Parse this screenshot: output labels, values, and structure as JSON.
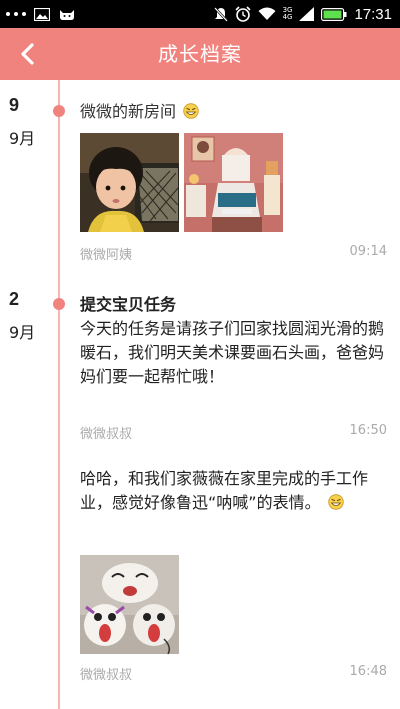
{
  "status_bar": {
    "time": "17:31",
    "network_label_top": "3G",
    "network_label_bottom": "4G",
    "icons": [
      "more-dots-icon",
      "image-icon",
      "cat-icon",
      "mute-icon",
      "alarm-icon",
      "wifi-icon",
      "signal-icon",
      "battery-icon"
    ]
  },
  "header": {
    "title": "成长档案",
    "back_icon": "chevron-left-icon",
    "bar_color": "#f1837f"
  },
  "colors": {
    "accent": "#f1837f",
    "timeline": "#f6b4b2",
    "meta_text": "#aaaaaa"
  },
  "timeline": [
    {
      "day": "9",
      "month": "9月",
      "posts": [
        {
          "title": "微微的新房间",
          "title_emoji": "grin-emoji-icon",
          "photos": [
            "child-photo",
            "bedroom-photo"
          ],
          "author": "微微阿姨",
          "time": "09:14"
        }
      ]
    },
    {
      "day": "2",
      "month": "9月",
      "posts": [
        {
          "title": "提交宝贝任务",
          "text": "今天的任务是请孩子们回家找圆润光滑的鹅暖石，我们明天美术课要画石头画，爸爸妈妈们要一起帮忙哦！",
          "author": "微微叔叔",
          "time": "16:50"
        },
        {
          "text": "哈哈，和我们家薇薇在家里完成的手工作业，感觉好像鲁迅“呐喊”的表情。",
          "text_emoji": "grin-emoji-icon",
          "photos": [
            "paper-plate-masks-photo"
          ],
          "author": "微微叔叔",
          "time": "16:48"
        }
      ]
    }
  ]
}
